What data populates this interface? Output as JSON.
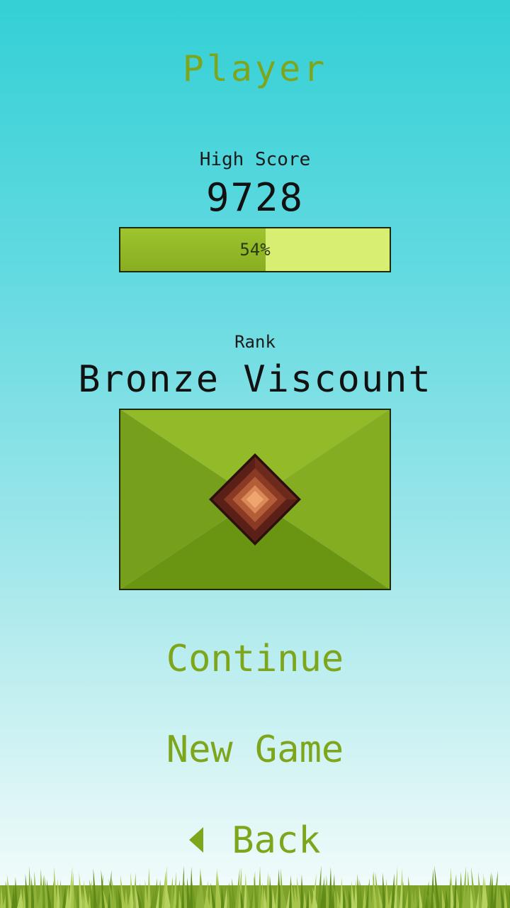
{
  "player": {
    "name": "Player"
  },
  "high_score": {
    "label": "High Score",
    "value": "9728",
    "progress_fraction": 0.54,
    "progress_text": "54%"
  },
  "rank": {
    "label": "Rank",
    "name": "Bronze Viscount",
    "badge_icon": "bronze-diamond-rank-icon"
  },
  "menu": {
    "continue_label": "Continue",
    "new_game_label": "New Game",
    "back_label": "Back",
    "back_icon": "left-triangle-arrow-icon"
  },
  "colors": {
    "accent_text": "#7ea61c",
    "progress_fill": "#8fb526",
    "progress_track": "#d8ee72",
    "panel_green": "#78a21a",
    "bronze": "#b8643a",
    "sky_top": "#33d0d6",
    "sky_bottom": "#f6fcfc"
  }
}
